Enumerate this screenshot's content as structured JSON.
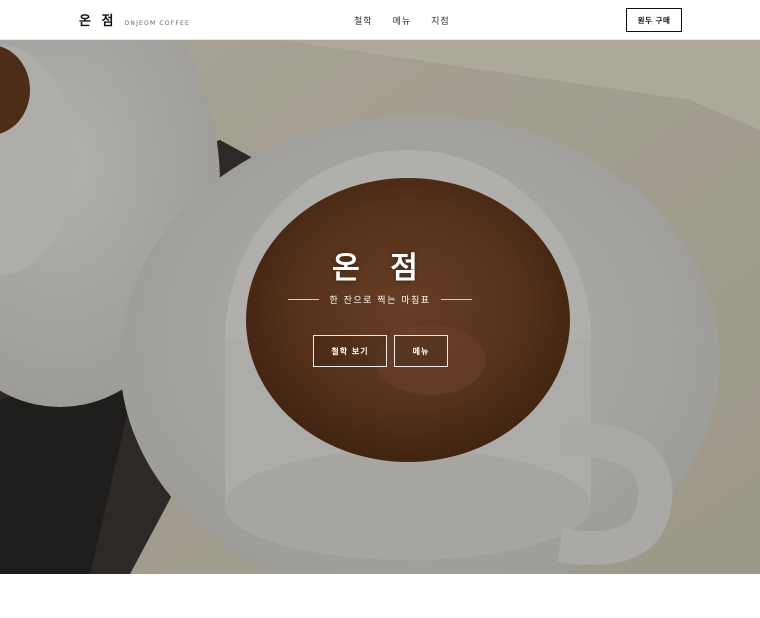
{
  "header": {
    "brand_ko": "온 점",
    "brand_en": "ONJEOM COFFEE",
    "nav": [
      "철학",
      "메뉴",
      "지점"
    ],
    "cta_label": "원두 구매"
  },
  "hero": {
    "title": "온 점",
    "tagline": "한 잔으로 찍는 마침표",
    "primary_button": "철학 보기",
    "secondary_button": "메뉴",
    "image": "coffee-cup-photo"
  },
  "colors": {
    "header_bg": "#ffffff",
    "text_dark": "#111111",
    "hero_text": "#ffffff",
    "coffee": "#7a4a2a",
    "saucer": "#eceae4"
  }
}
